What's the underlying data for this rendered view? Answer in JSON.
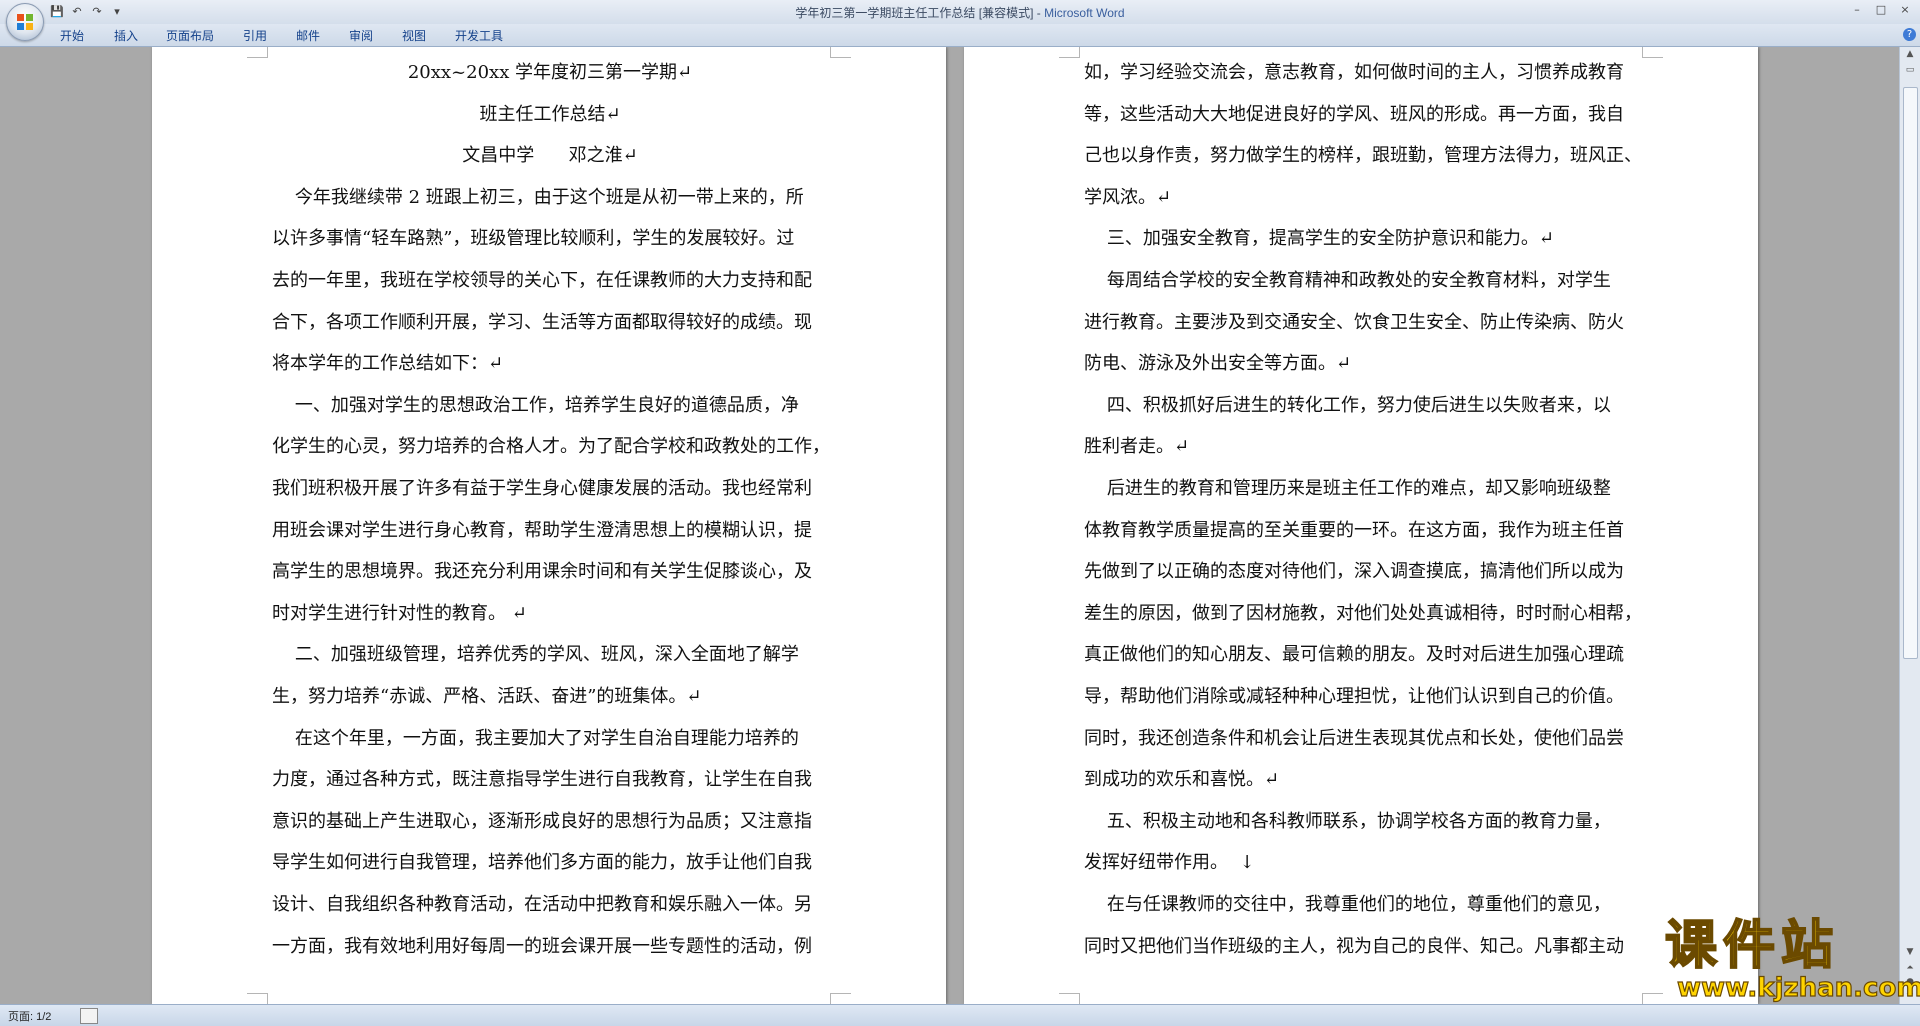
{
  "window": {
    "title": "学年初三第一学期班主任工作总结 [兼容模式] - ",
    "app_name": "Microsoft Word",
    "controls": [
      "–",
      "□",
      "×"
    ]
  },
  "ribbon": {
    "tabs": [
      "开始",
      "插入",
      "页面布局",
      "引用",
      "邮件",
      "审阅",
      "视图",
      "开发工具"
    ],
    "help": "?"
  },
  "page_left": {
    "lines": [
      {
        "text": "20xx~20xx 学年度初三第一学期↵",
        "align": "center"
      },
      {
        "text": "班主任工作总结↵",
        "align": "center"
      },
      {
        "text": "文昌中学      邓之淮↵",
        "align": "center"
      },
      {
        "text": "    今年我继续带 2 班跟上初三，由于这个班是从初一带上来的，所",
        "align": "left"
      },
      {
        "text": "以许多事情“轻车路熟”，班级管理比较顺利，学生的发展较好。过",
        "align": "left"
      },
      {
        "text": "去的一年里，我班在学校领导的关心下，在任课教师的大力支持和配",
        "align": "left"
      },
      {
        "text": "合下，各项工作顺利开展，学习、生活等方面都取得较好的成绩。现",
        "align": "left"
      },
      {
        "text": "将本学年的工作总结如下：↵",
        "align": "left"
      },
      {
        "text": "    一、加强对学生的思想政治工作，培养学生良好的道德品质，净",
        "align": "left"
      },
      {
        "text": "化学生的心灵，努力培养的合格人才。为了配合学校和政教处的工作，",
        "align": "left"
      },
      {
        "text": "我们班积极开展了许多有益于学生身心健康发展的活动。我也经常利",
        "align": "left"
      },
      {
        "text": "用班会课对学生进行身心教育，帮助学生澄清思想上的模糊认识，提",
        "align": "left"
      },
      {
        "text": "高学生的思想境界。我还充分利用课余时间和有关学生促膝谈心，及",
        "align": "left"
      },
      {
        "text": "时对学生进行针对性的教育。 ↵",
        "align": "left"
      },
      {
        "text": "    二、加强班级管理，培养优秀的学风、班风，深入全面地了解学",
        "align": "left"
      },
      {
        "text": "生，努力培养“赤诚、严格、活跃、奋进”的班集体。↵",
        "align": "left"
      },
      {
        "text": "    在这个年里，一方面，我主要加大了对学生自治自理能力培养的",
        "align": "left"
      },
      {
        "text": "力度，通过各种方式，既注意指导学生进行自我教育，让学生在自我",
        "align": "left"
      },
      {
        "text": "意识的基础上产生进取心，逐渐形成良好的思想行为品质；又注意指",
        "align": "left"
      },
      {
        "text": "导学生如何进行自我管理，培养他们多方面的能力，放手让他们自我",
        "align": "left"
      },
      {
        "text": "设计、自我组织各种教育活动，在活动中把教育和娱乐融入一体。另",
        "align": "left"
      },
      {
        "text": "一方面，我有效地利用好每周一的班会课开展一些专题性的活动，例",
        "align": "left"
      }
    ]
  },
  "page_right": {
    "lines": [
      {
        "text": "如，学习经验交流会，意志教育，如何做时间的主人，习惯养成教育",
        "align": "left"
      },
      {
        "text": "等，这些活动大大地促进良好的学风、班风的形成。再一方面，我自",
        "align": "left"
      },
      {
        "text": "己也以身作责，努力做学生的榜样，跟班勤，管理方法得力，班风正、",
        "align": "left"
      },
      {
        "text": "学风浓。↵",
        "align": "left"
      },
      {
        "text": "    三、加强安全教育，提高学生的安全防护意识和能力。↵",
        "align": "left"
      },
      {
        "text": "    每周结合学校的安全教育精神和政教处的安全教育材料，对学生",
        "align": "left"
      },
      {
        "text": "进行教育。主要涉及到交通安全、饮食卫生安全、防止传染病、防火",
        "align": "left"
      },
      {
        "text": "防电、游泳及外出安全等方面。↵",
        "align": "left"
      },
      {
        "text": "    四、积极抓好后进生的转化工作，努力使后进生以失败者来，以",
        "align": "left"
      },
      {
        "text": "胜利者走。↵",
        "align": "left"
      },
      {
        "text": "    后进生的教育和管理历来是班主任工作的难点，却又影响班级整",
        "align": "left"
      },
      {
        "text": "体教育教学质量提高的至关重要的一环。在这方面，我作为班主任首",
        "align": "left"
      },
      {
        "text": "先做到了以正确的态度对待他们，深入调查摸底，搞清他们所以成为",
        "align": "left"
      },
      {
        "text": "差生的原因，做到了因材施教，对他们处处真诚相待，时时耐心相帮，",
        "align": "left"
      },
      {
        "text": "真正做他们的知心朋友、最可信赖的朋友。及时对后进生加强心理疏",
        "align": "left"
      },
      {
        "text": "导，帮助他们消除或减轻种种心理担忧，让他们认识到自己的价值。",
        "align": "left"
      },
      {
        "text": "同时，我还创造条件和机会让后进生表现其优点和长处，使他们品尝",
        "align": "left"
      },
      {
        "text": "到成功的欢乐和喜悦。↵",
        "align": "left"
      },
      {
        "text": "    五、积极主动地和各科教师联系，协调学校各方面的教育力量，",
        "align": "left"
      },
      {
        "text": "发挥好纽带作用。  ↓",
        "align": "left"
      },
      {
        "text": "    在与任课教师的交往中，我尊重他们的地位，尊重他们的意见，",
        "align": "left"
      },
      {
        "text": "同时又把他们当作班级的主人，视为自己的良伴、知己。凡事都主动",
        "align": "left"
      }
    ]
  },
  "statusbar": {
    "page_info": "页面: 1/2"
  },
  "watermark": {
    "text_cn": "课件站",
    "url": "www.kjzhan.com"
  }
}
